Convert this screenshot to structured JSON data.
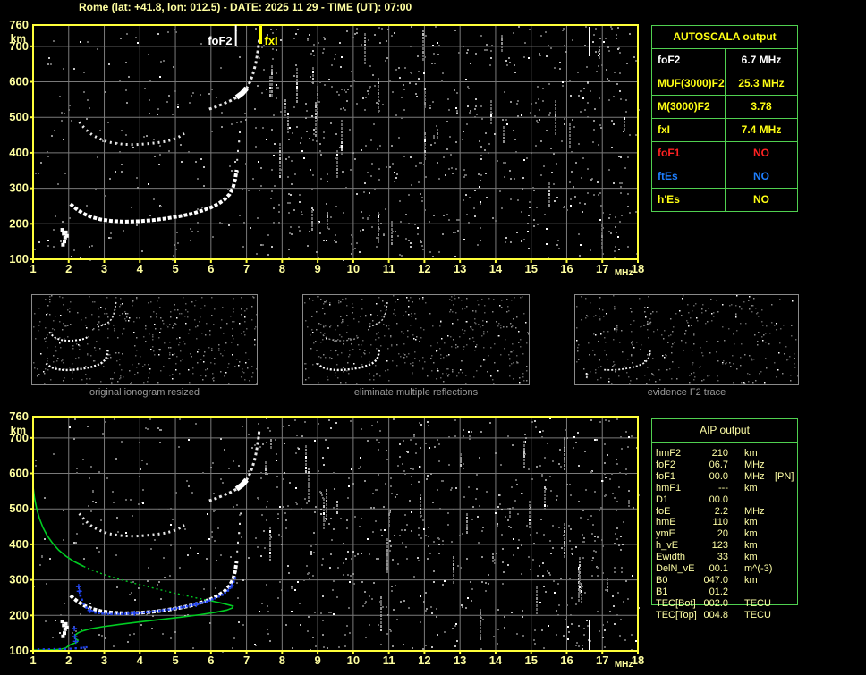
{
  "title": "Rome (lat: +41.8, lon: 012.5) - DATE: 2025 11 29 - TIME (UT): 07:00",
  "colors": {
    "background": "#000000",
    "axis_yellow": "#ffff3a",
    "pale_yellow": "#ffffa0",
    "bright_yellow": "#ffff14",
    "white": "#ffffff",
    "red": "#ff2222",
    "blue": "#1e7fff",
    "table_green": "#50d050",
    "grid_gray": "#7a7a7a",
    "caption_gray": "#9a9a9a",
    "profile_green": "#00cc22",
    "trace_blue": "#2143ee"
  },
  "chart_data": [
    {
      "id": "top-ionogram",
      "type": "scatter",
      "title": "ionogram with AUTOSCALA markers",
      "xlabel": "MHz",
      "ylabel": "km",
      "x_range": [
        1,
        18
      ],
      "y_range": [
        100,
        760
      ],
      "x_ticks": [
        1,
        2,
        3,
        4,
        5,
        6,
        7,
        8,
        9,
        10,
        11,
        12,
        13,
        14,
        15,
        16,
        17,
        18
      ],
      "y_ticks": [
        100,
        200,
        300,
        400,
        500,
        600,
        700,
        760
      ],
      "grid": true,
      "markers": [
        {
          "label": "foF2",
          "freq_mhz": 6.7,
          "color": "white"
        },
        {
          "label": "fxI",
          "freq_mhz": 7.4,
          "color": "yellow"
        }
      ],
      "series": [
        {
          "name": "F2 echo trace",
          "points": [
            [
              2.05,
              256
            ],
            [
              2.15,
              247
            ],
            [
              2.28,
              237
            ],
            [
              2.45,
              227
            ],
            [
              2.65,
              219
            ],
            [
              2.9,
              212
            ],
            [
              3.2,
              208
            ],
            [
              3.55,
              206
            ],
            [
              3.95,
              207
            ],
            [
              4.35,
              210
            ],
            [
              4.75,
              215
            ],
            [
              5.1,
              221
            ],
            [
              5.45,
              228
            ],
            [
              5.75,
              237
            ],
            [
              6.0,
              246
            ],
            [
              6.2,
              256
            ],
            [
              6.38,
              268
            ],
            [
              6.52,
              283
            ],
            [
              6.62,
              302
            ],
            [
              6.68,
              325
            ],
            [
              6.72,
              352
            ]
          ]
        },
        {
          "name": "F2 asymptote dots",
          "points": [
            [
              6.74,
              380
            ],
            [
              6.76,
              405
            ],
            [
              6.79,
              432
            ],
            [
              6.81,
              458
            ],
            [
              6.84,
              487
            ]
          ]
        },
        {
          "name": "second hop arc",
          "points": [
            [
              2.3,
              487
            ],
            [
              2.42,
              472
            ],
            [
              2.55,
              459
            ],
            [
              2.7,
              448
            ],
            [
              2.88,
              439
            ],
            [
              3.08,
              431
            ],
            [
              3.3,
              427
            ],
            [
              3.55,
              424
            ],
            [
              3.85,
              423
            ],
            [
              4.15,
              425
            ],
            [
              4.45,
              428
            ],
            [
              4.72,
              432
            ],
            [
              4.95,
              438
            ],
            [
              5.12,
              446
            ],
            [
              5.25,
              455
            ]
          ]
        },
        {
          "name": "second hop rise",
          "points": [
            [
              5.95,
              523
            ],
            [
              6.15,
              530
            ],
            [
              6.35,
              538
            ],
            [
              6.55,
              547
            ],
            [
              6.72,
              556
            ],
            [
              6.88,
              568
            ],
            [
              7.0,
              582
            ],
            [
              7.1,
              600
            ],
            [
              7.18,
              622
            ],
            [
              7.25,
              648
            ],
            [
              7.3,
              675
            ],
            [
              7.34,
              703
            ],
            [
              7.36,
              725
            ]
          ]
        },
        {
          "name": "E region echoes",
          "points": [
            [
              1.82,
              183
            ],
            [
              1.86,
              172
            ],
            [
              1.9,
              161
            ],
            [
              1.88,
              150
            ],
            [
              1.84,
              141
            ],
            [
              1.92,
              176
            ],
            [
              1.95,
              166
            ]
          ]
        }
      ]
    },
    {
      "id": "bottom-ionogram",
      "type": "scatter",
      "title": "ionogram with inverted electron density profile",
      "xlabel": "MHz",
      "ylabel": "km",
      "x_range": [
        1,
        18
      ],
      "y_range": [
        100,
        760
      ],
      "x_ticks": [
        1,
        2,
        3,
        4,
        5,
        6,
        7,
        8,
        9,
        10,
        11,
        12,
        13,
        14,
        15,
        16,
        17,
        18
      ],
      "y_ticks": [
        100,
        200,
        300,
        400,
        500,
        600,
        700,
        760
      ],
      "grid": true,
      "markers": [],
      "series_same_as": "top-ionogram",
      "overlays": [
        {
          "name": "electron density profile",
          "color": "green",
          "points": [
            [
              1.0,
              562
            ],
            [
              1.04,
              530
            ],
            [
              1.1,
              500
            ],
            [
              1.18,
              472
            ],
            [
              1.28,
              447
            ],
            [
              1.4,
              424
            ],
            [
              1.55,
              403
            ],
            [
              1.72,
              384
            ],
            [
              1.92,
              367
            ],
            [
              2.15,
              352
            ],
            [
              2.42,
              338
            ],
            [
              2.72,
              325
            ],
            [
              3.05,
              313
            ],
            [
              3.42,
              302
            ],
            [
              3.82,
              291
            ],
            [
              4.25,
              280
            ],
            [
              4.7,
              269
            ],
            [
              5.15,
              259
            ],
            [
              5.6,
              249
            ],
            [
              6.0,
              241
            ],
            [
              6.32,
              234
            ],
            [
              6.52,
              229
            ],
            [
              6.62,
              226
            ],
            [
              6.6,
              221
            ],
            [
              6.45,
              215
            ],
            [
              6.15,
              209
            ],
            [
              5.7,
              202
            ],
            [
              5.15,
              195
            ],
            [
              4.55,
              188
            ],
            [
              3.95,
              181
            ],
            [
              3.4,
              174
            ],
            [
              2.95,
              168
            ],
            [
              2.6,
              162
            ],
            [
              2.38,
              156
            ],
            [
              2.25,
              150
            ],
            [
              2.18,
              144
            ],
            [
              2.16,
              139
            ],
            [
              2.2,
              134
            ],
            [
              2.26,
              130
            ],
            [
              2.24,
              125
            ],
            [
              2.14,
              121
            ],
            [
              2.04,
              117
            ],
            [
              1.97,
              112
            ],
            [
              1.92,
              108
            ],
            [
              1.8,
              105
            ],
            [
              1.6,
              103
            ],
            [
              1.3,
              102
            ],
            [
              1.0,
              102
            ]
          ]
        },
        {
          "name": "restored F2 trace",
          "color": "blue",
          "points": [
            [
              2.3,
              268
            ],
            [
              2.33,
              256
            ],
            [
              2.37,
              244
            ],
            [
              2.42,
              233
            ],
            [
              2.5,
              222
            ],
            [
              2.6,
              214
            ],
            [
              2.75,
              208
            ],
            [
              2.95,
              205
            ],
            [
              3.2,
              204
            ],
            [
              3.5,
              204
            ],
            [
              3.85,
              206
            ],
            [
              4.2,
              209
            ],
            [
              4.55,
              213
            ],
            [
              4.9,
              218
            ],
            [
              5.25,
              224
            ],
            [
              5.58,
              231
            ],
            [
              5.88,
              239
            ],
            [
              6.12,
              248
            ],
            [
              6.32,
              258
            ],
            [
              6.48,
              270
            ],
            [
              6.58,
              283
            ],
            [
              6.64,
              295
            ],
            [
              6.68,
              305
            ]
          ]
        },
        {
          "name": "E trace",
          "color": "blue",
          "points": [
            [
              1.0,
              104
            ],
            [
              1.15,
              104
            ],
            [
              1.3,
              104
            ],
            [
              1.45,
              104
            ],
            [
              1.6,
              105
            ],
            [
              1.75,
              105
            ],
            [
              1.9,
              105
            ],
            [
              2.05,
              106
            ],
            [
              2.2,
              107
            ],
            [
              2.35,
              108
            ],
            [
              2.5,
              110
            ]
          ]
        },
        {
          "name": "plus marks",
          "color": "blue",
          "points": [
            [
              2.16,
              163
            ],
            [
              2.17,
              140
            ],
            [
              2.2,
              127
            ],
            [
              2.28,
              281
            ]
          ]
        }
      ]
    }
  ],
  "thumbnails": [
    {
      "caption": "original ionogram resized"
    },
    {
      "caption": "eliminate multiple reflections"
    },
    {
      "caption": "evidence F2 trace"
    }
  ],
  "autoscala_table": {
    "title": "AUTOSCALA output",
    "rows": [
      {
        "label": "foF2",
        "value": "6.7 MHz",
        "color": "white"
      },
      {
        "label": "MUF(3000)F2",
        "value": "25.3 MHz",
        "color": "yellow"
      },
      {
        "label": "M(3000)F2",
        "value": "3.78",
        "color": "yellow"
      },
      {
        "label": "fxI",
        "value": "7.4 MHz",
        "color": "yellow"
      },
      {
        "label": "foF1",
        "value": "NO",
        "color": "red"
      },
      {
        "label": "ftEs",
        "value": "NO",
        "color": "blue"
      },
      {
        "label": "h'Es",
        "value": "NO",
        "color": "yellow"
      }
    ]
  },
  "aip_table": {
    "title": "AIP output",
    "rows": [
      {
        "label": "hmF2",
        "value": "210",
        "unit": "km",
        "note": ""
      },
      {
        "label": "foF2",
        "value": "06.7",
        "unit": "MHz",
        "note": ""
      },
      {
        "label": "foF1",
        "value": "00.0",
        "unit": "MHz",
        "note": "[PN]"
      },
      {
        "label": "hmF1",
        "value": "---",
        "unit": "km",
        "note": ""
      },
      {
        "label": "D1",
        "value": "00.0",
        "unit": "",
        "note": ""
      },
      {
        "label": "foE",
        "value": "2.2",
        "unit": "MHz",
        "note": ""
      },
      {
        "label": "hmE",
        "value": "110",
        "unit": "km",
        "note": ""
      },
      {
        "label": "ymE",
        "value": "20",
        "unit": "km",
        "note": ""
      },
      {
        "label": "h_vE",
        "value": "123",
        "unit": "km",
        "note": ""
      },
      {
        "label": "Ewidth",
        "value": "33",
        "unit": "km",
        "note": ""
      },
      {
        "label": "DelN_vE",
        "value": "00.1",
        "unit": "m^(-3)",
        "note": ""
      },
      {
        "label": "B0",
        "value": "047.0",
        "unit": "km",
        "note": ""
      },
      {
        "label": "B1",
        "value": "01.2",
        "unit": "",
        "note": ""
      },
      {
        "label": "TEC[Bot]",
        "value": "002.0",
        "unit": "TECU",
        "note": ""
      },
      {
        "label": "TEC[Top]",
        "value": "004.8",
        "unit": "TECU",
        "note": ""
      }
    ]
  }
}
